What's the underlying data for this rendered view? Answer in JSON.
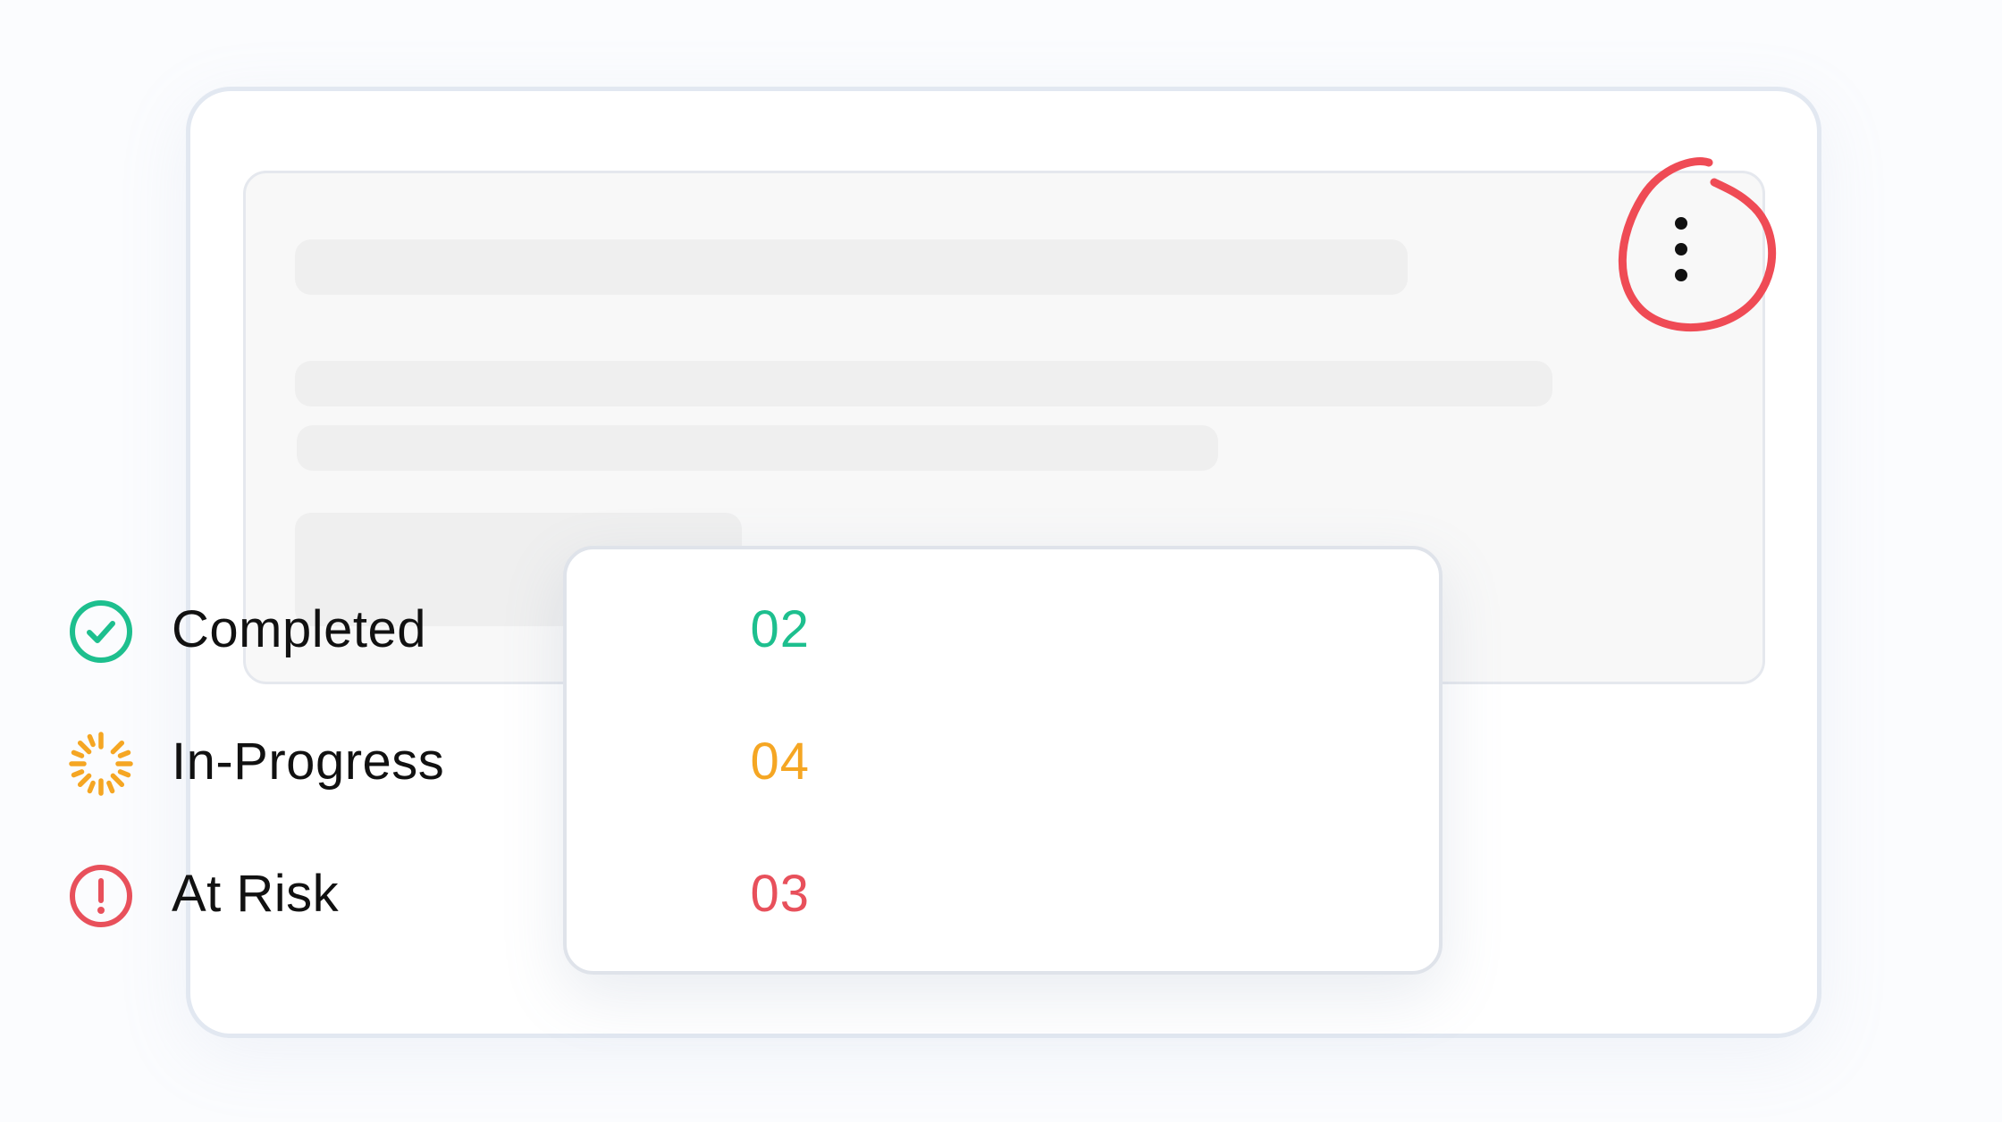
{
  "colors": {
    "completed": "#1dbf8e",
    "in_progress": "#f5a623",
    "at_risk": "#e8505b",
    "annotation": "#ef4b55"
  },
  "card": {
    "menu_icon": "more-vertical-icon"
  },
  "status_menu": {
    "items": [
      {
        "label": "Completed",
        "count": "02",
        "icon": "check-circle-icon"
      },
      {
        "label": "In-Progress",
        "count": "04",
        "icon": "spinner-icon"
      },
      {
        "label": "At Risk",
        "count": "03",
        "icon": "alert-circle-icon"
      }
    ]
  }
}
